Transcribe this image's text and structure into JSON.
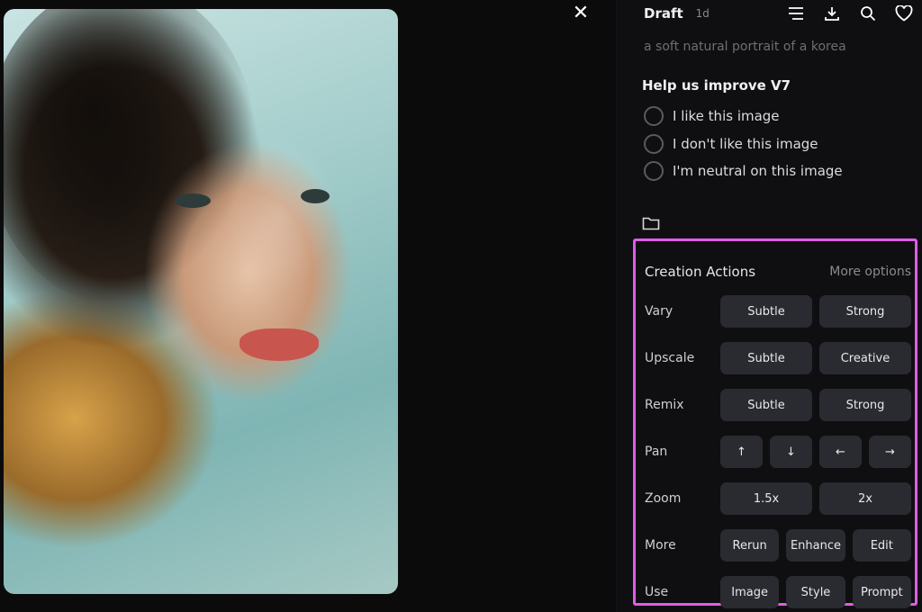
{
  "header": {
    "title": "Draft",
    "age": "1d",
    "icons": [
      "menu-icon",
      "download-icon",
      "search-icon",
      "heart-icon"
    ],
    "close_glyph": "✕"
  },
  "prompt_preview": "a soft natural portrait of a korea",
  "feedback": {
    "title": "Help us improve V7",
    "options": [
      "I like this image",
      "I don't like this image",
      "I'm neutral on this image"
    ]
  },
  "creation": {
    "title": "Creation Actions",
    "more": "More options",
    "rows": [
      {
        "label": "Vary",
        "buttons": [
          "Subtle",
          "Strong"
        ]
      },
      {
        "label": "Upscale",
        "buttons": [
          "Subtle",
          "Creative"
        ]
      },
      {
        "label": "Remix",
        "buttons": [
          "Subtle",
          "Strong"
        ]
      },
      {
        "label": "Pan",
        "buttons": [
          "↑",
          "↓",
          "←",
          "→"
        ]
      },
      {
        "label": "Zoom",
        "buttons": [
          "1.5x",
          "2x"
        ]
      },
      {
        "label": "More",
        "buttons": [
          "Rerun",
          "Enhance",
          "Edit"
        ]
      },
      {
        "label": "Use",
        "buttons": [
          "Image",
          "Style",
          "Prompt"
        ]
      }
    ]
  },
  "colors": {
    "highlight": "#e25be8",
    "panel_bg": "#0f0f11",
    "button_bg": "#2a2b30"
  }
}
